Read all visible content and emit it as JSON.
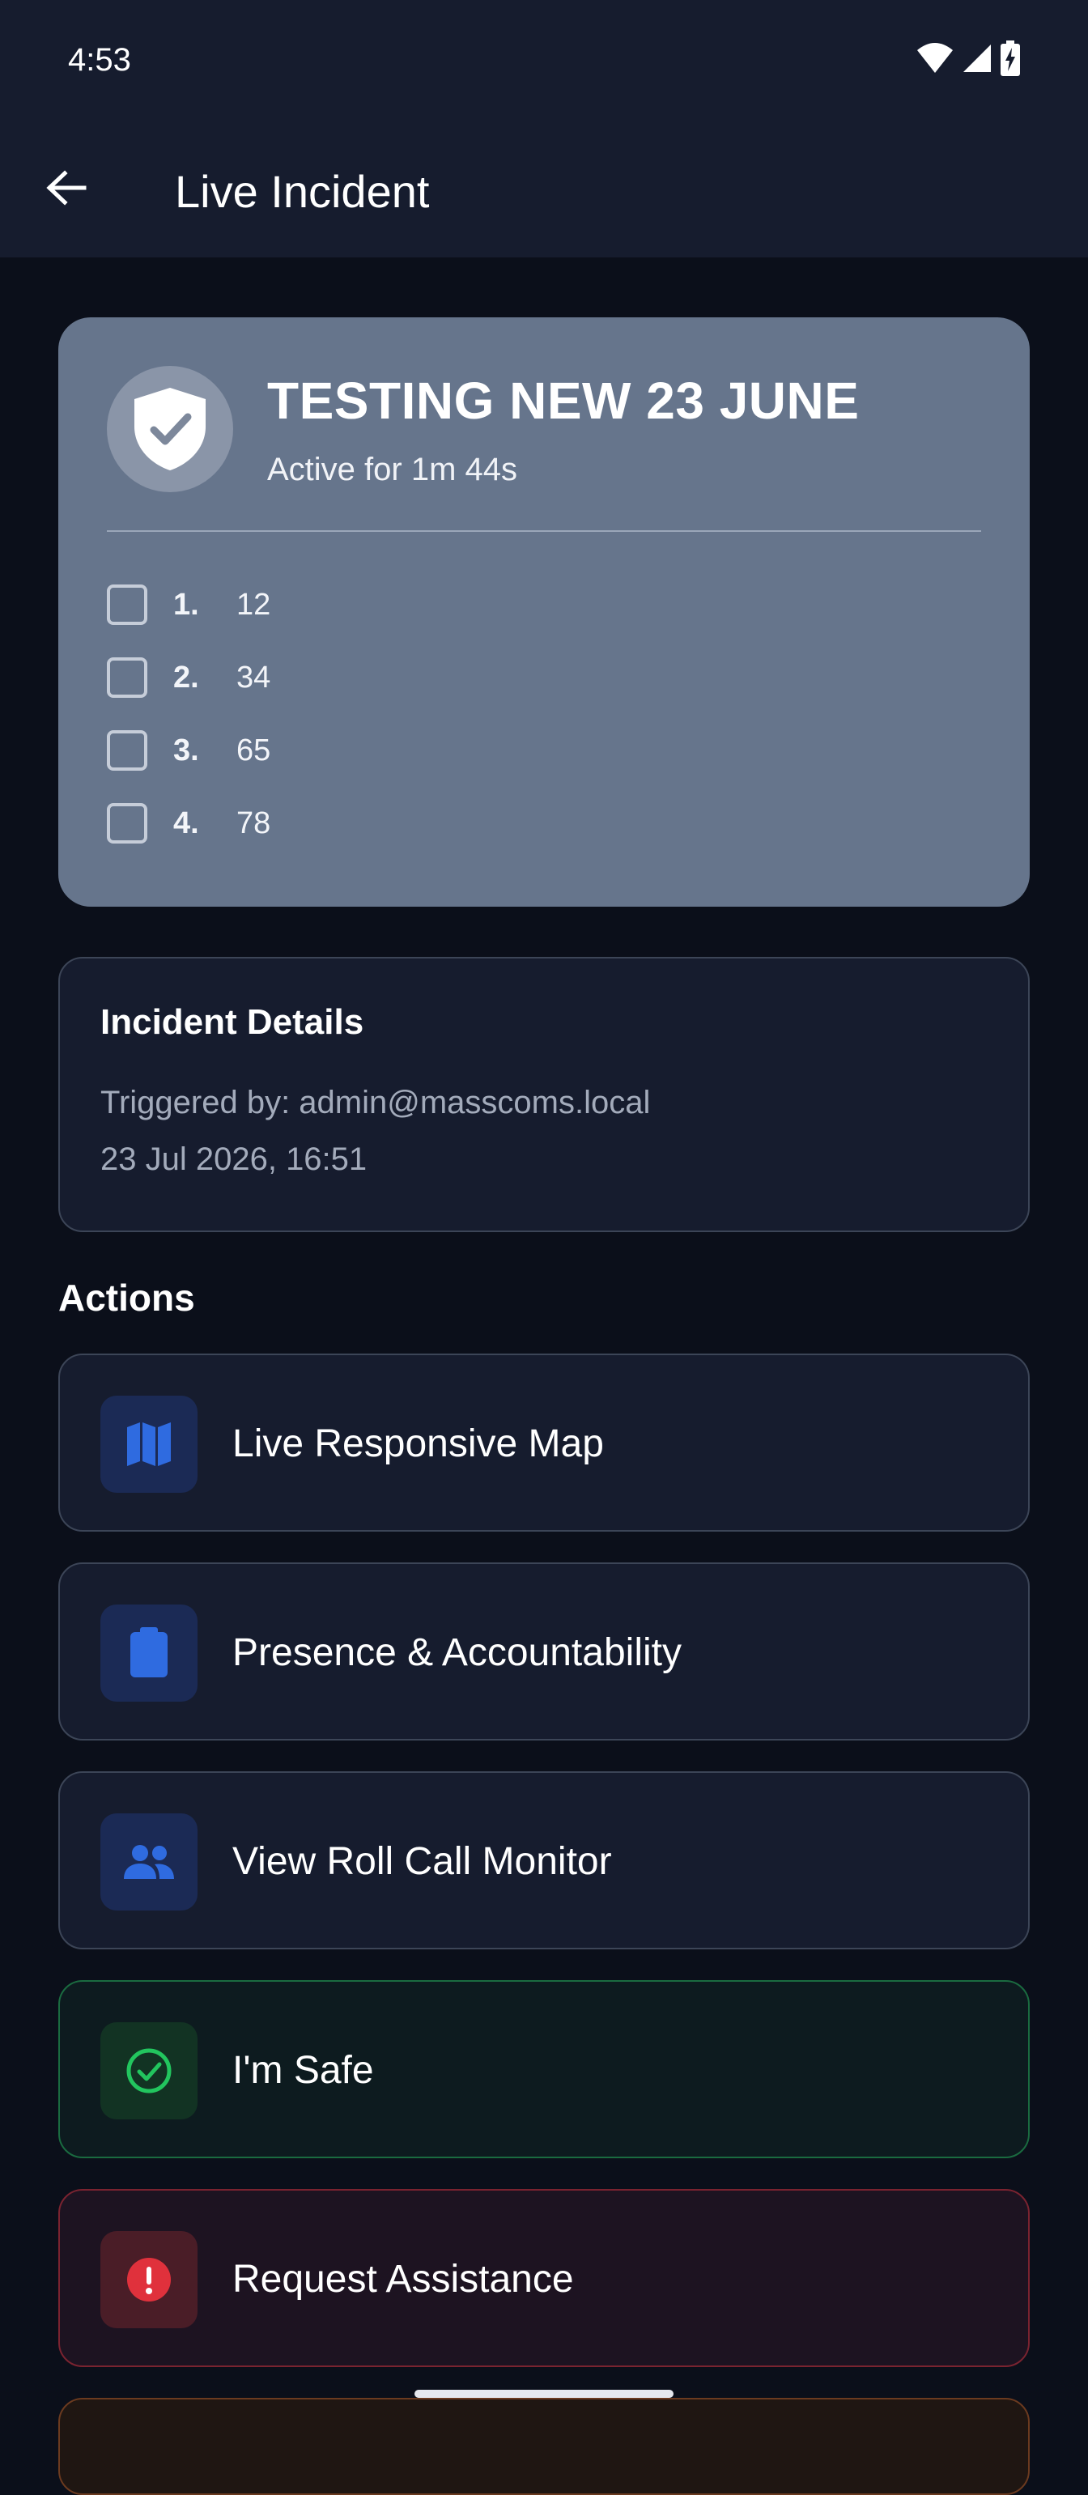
{
  "status_bar": {
    "time": "4:53",
    "icons": [
      "wifi-icon",
      "cellular-signal-icon",
      "battery-charging-icon"
    ]
  },
  "app_bar": {
    "title": "Live Incident",
    "back_icon": "arrow-left-icon"
  },
  "incident": {
    "icon": "shield-check-icon",
    "title": "TESTING NEW 23 JUNE",
    "active_text": "Active for 1m 44s",
    "checklist": [
      {
        "number": "1.",
        "text": "12",
        "checked": false
      },
      {
        "number": "2.",
        "text": "34",
        "checked": false
      },
      {
        "number": "3.",
        "text": "65",
        "checked": false
      },
      {
        "number": "4.",
        "text": "78",
        "checked": false
      }
    ]
  },
  "details": {
    "title": "Incident Details",
    "triggered_by": "Triggered by: admin@masscoms.local",
    "timestamp": "23 Jul 2026, 16:51"
  },
  "actions": {
    "heading": "Actions",
    "items": [
      {
        "label": "Live Responsive Map",
        "icon": "map-icon"
      },
      {
        "label": "Presence & Accountability",
        "icon": "clipboard-icon"
      },
      {
        "label": "View Roll Call Monitor",
        "icon": "people-icon"
      },
      {
        "label": "I'm Safe",
        "icon": "check-circle-icon"
      },
      {
        "label": "Request Assistance",
        "icon": "alert-circle-icon"
      }
    ]
  },
  "colors": {
    "background": "#0b0f1a",
    "surface": "#161c2e",
    "incident_card": "#66758c",
    "accent_blue": "#2f6be0",
    "safe_green": "#22c55e",
    "alert_red": "#e0313c"
  }
}
